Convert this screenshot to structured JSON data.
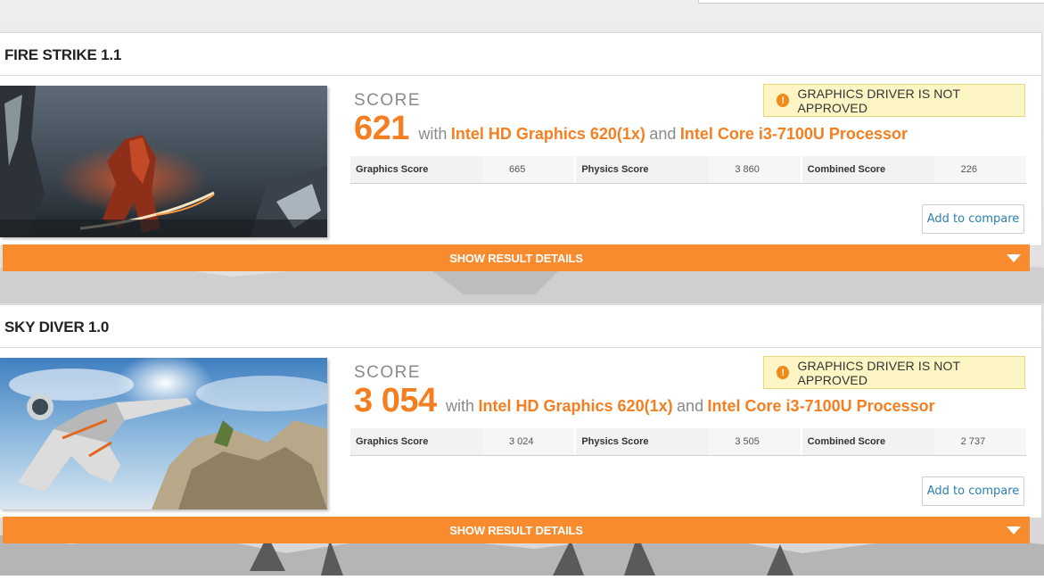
{
  "colors": {
    "accent": "#f57f20",
    "details_bar": "#f78b2d",
    "warning_bg": "#fdf6c4",
    "link": "#2a7fb0"
  },
  "results": [
    {
      "title": "FIRE STRIKE 1.1",
      "score_label": "SCORE",
      "score": "621",
      "with_text": "with",
      "gpu": "Intel HD Graphics 620(1x)",
      "and_text": "and",
      "cpu": "Intel Core i3-7100U Processor",
      "warning": "GRAPHICS DRIVER IS NOT APPROVED",
      "warning_icon": "exclamation-icon",
      "sub_scores": [
        {
          "name": "Graphics Score",
          "value": "665"
        },
        {
          "name": "Physics Score",
          "value": "3 860"
        },
        {
          "name": "Combined Score",
          "value": "226"
        }
      ],
      "compare_label": "Add to compare",
      "details_label": "SHOW RESULT DETAILS"
    },
    {
      "title": "SKY DIVER 1.0",
      "score_label": "SCORE",
      "score": "3 054",
      "with_text": "with",
      "gpu": "Intel HD Graphics 620(1x)",
      "and_text": "and",
      "cpu": "Intel Core i3-7100U Processor",
      "warning": "GRAPHICS DRIVER IS NOT APPROVED",
      "warning_icon": "exclamation-icon",
      "sub_scores": [
        {
          "name": "Graphics Score",
          "value": "3 024"
        },
        {
          "name": "Physics Score",
          "value": "3 505"
        },
        {
          "name": "Combined Score",
          "value": "2 737"
        }
      ],
      "compare_label": "Add to compare",
      "details_label": "SHOW RESULT DETAILS"
    }
  ]
}
